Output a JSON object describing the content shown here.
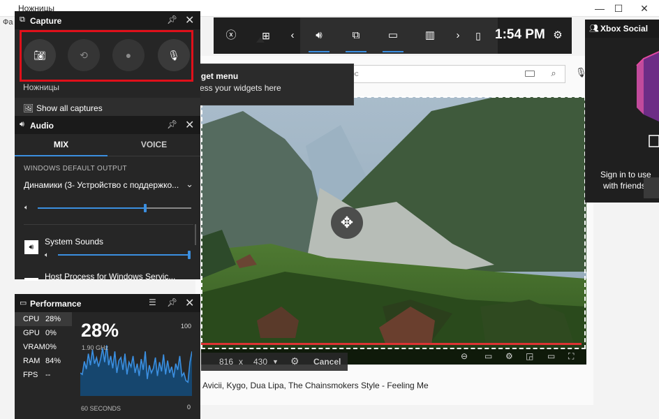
{
  "background_window": {
    "title": "Ножницы",
    "menu_label": "Фа",
    "search_placeholder": "ос",
    "song_title": "Avicii, Kygo, Dua Lipa, The Chainsmokers Style - Feeling Me",
    "capture_size": {
      "width": "816",
      "separator": "x",
      "height": "430",
      "cancel_label": "Cancel"
    }
  },
  "gamebar": {
    "time": "1:54 PM",
    "buttons": [
      "xbox",
      "widget-menu",
      "prev",
      "audio",
      "capture",
      "performance",
      "stats",
      "next",
      "mouse",
      "settings"
    ]
  },
  "tooltip": {
    "title": "Widget menu",
    "subtitle": "Access your widgets here"
  },
  "capture_widget": {
    "title": "Capture",
    "app_label": "Ножницы",
    "show_all_label": "Show all captures"
  },
  "audio_widget": {
    "title": "Audio",
    "tabs": [
      {
        "label": "MIX",
        "active": true
      },
      {
        "label": "VOICE",
        "active": false
      }
    ],
    "section_label": "WINDOWS DEFAULT OUTPUT",
    "device": "Динамики (3- Устройство с поддержко...",
    "master_volume": 0.7,
    "apps": [
      {
        "name": "System Sounds",
        "volume": 1.0
      },
      {
        "name": "Host Process for Windows Servic..."
      }
    ]
  },
  "performance_widget": {
    "title": "Performance",
    "metrics": [
      {
        "key": "CPU",
        "value": "28%",
        "active": true
      },
      {
        "key": "GPU",
        "value": "0%",
        "active": false
      },
      {
        "key": "VRAM",
        "value": "0%",
        "active": false
      },
      {
        "key": "RAM",
        "value": "84%",
        "active": false
      },
      {
        "key": "FPS",
        "value": "--",
        "active": false
      }
    ],
    "big_value": "28%",
    "sub_value": "1.90 GHz",
    "max_label": "100",
    "min_label": "0",
    "x_label": "60 SECONDS",
    "cpu_history": [
      30,
      28,
      45,
      35,
      55,
      40,
      60,
      42,
      50,
      38,
      48,
      62,
      44,
      66,
      40,
      52,
      36,
      58,
      30,
      46,
      50,
      34,
      55,
      28,
      44,
      38,
      52,
      30,
      42,
      26,
      48,
      34,
      58,
      22,
      40,
      30,
      36,
      50,
      26,
      44,
      32,
      54,
      28,
      46,
      30,
      38,
      24,
      42,
      34,
      52,
      26,
      30,
      20,
      18,
      44,
      58
    ]
  },
  "social_widget": {
    "title": "Xbox Social",
    "line1": "Sign in to use",
    "line2": "with friends o"
  },
  "colors": {
    "accent": "#3b8fe0",
    "highlight": "#e0101a",
    "panel": "#1f1f1f"
  }
}
